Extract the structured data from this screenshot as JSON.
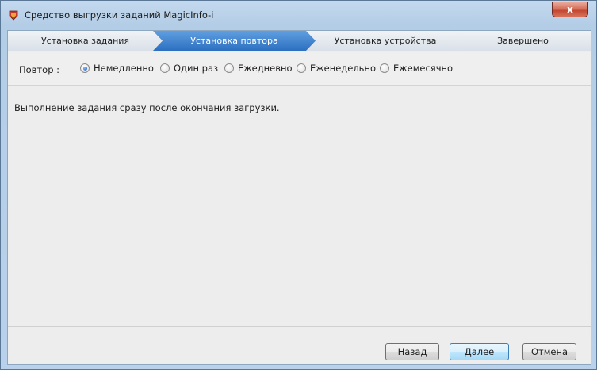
{
  "window": {
    "title": "Средство выгрузки заданий MagicInfo-i",
    "close_label": "x"
  },
  "steps": [
    {
      "label": "Установка задания",
      "active": false
    },
    {
      "label": "Установка повтора",
      "active": true
    },
    {
      "label": "Установка устройства",
      "active": false
    },
    {
      "label": "Завершено",
      "active": false
    }
  ],
  "repeat": {
    "label": "Повтор :",
    "options": [
      {
        "label": "Немедленно",
        "checked": true
      },
      {
        "label": "Один раз",
        "checked": false
      },
      {
        "label": "Ежедневно",
        "checked": false
      },
      {
        "label": "Еженедельно",
        "checked": false
      },
      {
        "label": "Ежемесячно",
        "checked": false
      }
    ]
  },
  "description": "Выполнение задания сразу после окончания загрузки.",
  "buttons": {
    "back": "Назад",
    "next": "Далее",
    "cancel": "Отмена"
  },
  "colors": {
    "active_step": "#2c6fc0",
    "close_button": "#c0402a"
  }
}
